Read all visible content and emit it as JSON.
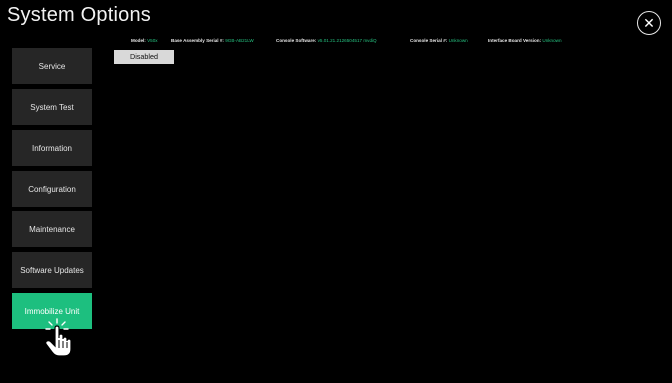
{
  "header": {
    "title": "System Options",
    "close_icon": "close-icon"
  },
  "info": [
    {
      "label": "Model:",
      "value": "V50x"
    },
    {
      "label": "Base Assembly Serial #:",
      "value": "9GB-AB21LW"
    },
    {
      "label": "Console Software:",
      "value": "v5.01.21.2126504517 mvdiQ"
    },
    {
      "label": "Console Serial #:",
      "value": "Unknown"
    },
    {
      "label": "Interface Board Version:",
      "value": "Unknown"
    }
  ],
  "sidebar": {
    "items": [
      {
        "label": "Service"
      },
      {
        "label": "System Test"
      },
      {
        "label": "Information"
      },
      {
        "label": "Configuration"
      },
      {
        "label": "Maintenance"
      },
      {
        "label": "Software Updates"
      },
      {
        "label": "Immobilize Unit",
        "active": true
      }
    ]
  },
  "main": {
    "status_label": "Disabled"
  },
  "colors": {
    "accent": "#1dbf7f",
    "value_text": "#26c281",
    "background": "#000000",
    "menu_button": "#262626"
  },
  "pointer": {
    "icon": "hand-pointer-cursor-icon"
  }
}
